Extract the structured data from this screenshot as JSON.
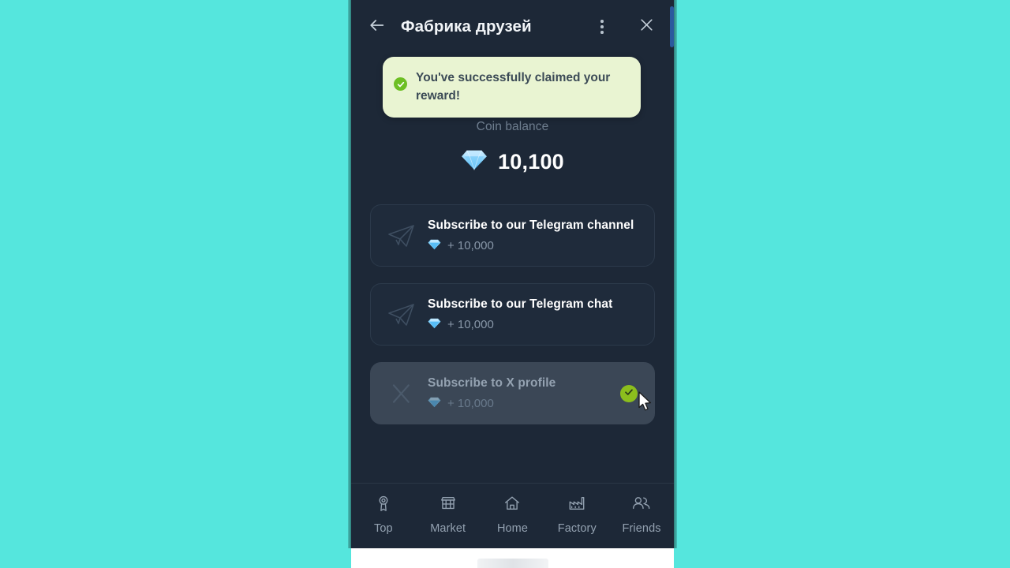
{
  "window": {
    "background_color": "#55e6dd",
    "panel_color": "#1d2837"
  },
  "header": {
    "title": "Фабрика друзей",
    "back_icon": "arrow-left-icon",
    "menu_icon": "more-vertical-icon",
    "close_icon": "close-icon"
  },
  "toast": {
    "message": "You've successfully claimed your reward!",
    "icon": "check-circle-icon",
    "background_color": "#e9f4d2",
    "accent_color": "#6dbf23"
  },
  "balance": {
    "label": "Coin balance",
    "icon": "gem-icon",
    "value": "10,100"
  },
  "tasks": [
    {
      "title": "Subscribe to our Telegram channel",
      "reward": "+ 10,000",
      "icon": "telegram-icon",
      "reward_icon": "gem-icon",
      "completed": false
    },
    {
      "title": "Subscribe to our Telegram chat",
      "reward": "+ 10,000",
      "icon": "telegram-icon",
      "reward_icon": "gem-icon",
      "completed": false
    },
    {
      "title": "Subscribe to X profile",
      "reward": "+ 10,000",
      "icon": "x-twitter-icon",
      "reward_icon": "gem-icon",
      "completed": true,
      "completed_icon": "check-circle-icon",
      "completed_color": "#8cbe1d"
    }
  ],
  "bottom_nav": [
    {
      "label": "Top",
      "icon": "medal-icon"
    },
    {
      "label": "Market",
      "icon": "store-icon"
    },
    {
      "label": "Home",
      "icon": "home-icon"
    },
    {
      "label": "Factory",
      "icon": "factory-icon"
    },
    {
      "label": "Friends",
      "icon": "friends-icon"
    }
  ],
  "cursor": {
    "icon": "mouse-pointer-icon"
  }
}
